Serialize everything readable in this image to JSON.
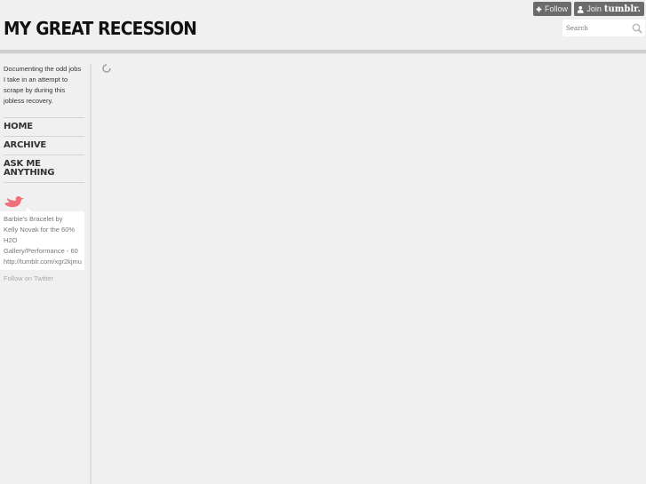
{
  "header": {
    "title": "MY GREAT RECESSION",
    "follow_label": "Follow",
    "join_label": "Join",
    "join_brand": "tumblr.",
    "search_placeholder": "Search"
  },
  "sidebar": {
    "description": "Documenting the odd jobs I take in an attempt to scrape by during this jobless recovery.",
    "nav": [
      {
        "label": "HOME"
      },
      {
        "label": "ARCHIVE"
      },
      {
        "label": "ASK ME ANYTHING"
      }
    ],
    "twitter": {
      "tweet_lines": [
        "Barbie's Bracelet by",
        "Kelly Novak for the 60%",
        "H2O",
        "Gallery/Performance - 60",
        "http://tumblr.com/xgr2kjmu"
      ],
      "follow_label": "Follow on Twitter",
      "bird_color": "#f0707a"
    }
  },
  "main": {
    "loading_icon": "spinner-icon"
  }
}
